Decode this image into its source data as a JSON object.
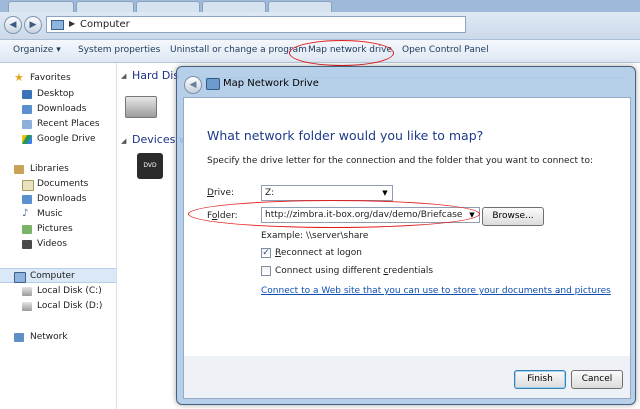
{
  "explorer": {
    "address": {
      "crumb": "Computer"
    },
    "toolbar": {
      "organize": "Organize",
      "system_properties": "System properties",
      "uninstall": "Uninstall or change a program",
      "map_network_drive": "Map network drive",
      "open_control_panel": "Open Control Panel"
    },
    "nav": {
      "favorites": "Favorites",
      "desktop": "Desktop",
      "downloads": "Downloads",
      "recent_places": "Recent Places",
      "google_drive": "Google Drive",
      "libraries": "Libraries",
      "documents": "Documents",
      "lib_downloads": "Downloads",
      "music": "Music",
      "pictures": "Pictures",
      "videos": "Videos",
      "computer": "Computer",
      "local_c": "Local Disk (C:)",
      "local_d": "Local Disk (D:)",
      "network": "Network"
    },
    "content": {
      "hard_disk_header": "Hard Dis",
      "devices_header": "Devices w",
      "dvd_label": "DVD"
    }
  },
  "dialog": {
    "title": "Map Network Drive",
    "heading": "What network folder would you like to map?",
    "instruction": "Specify the drive letter for the connection and the folder that you want to connect to:",
    "drive_label_pre": "",
    "drive_label_key": "D",
    "drive_label_post": "rive:",
    "drive_value": "Z:",
    "folder_label_pre": "F",
    "folder_label_key": "o",
    "folder_label_post": "lder:",
    "folder_value": "http://zimbra.it-box.org/dav/demo/Briefcase",
    "browse_label": "Browse...",
    "example": "Example: \\\\server\\share",
    "reconnect_pre": "",
    "reconnect_key": "R",
    "reconnect_post": "econnect at logon",
    "reconnect_checked": true,
    "credentials_pre": "Connect using different ",
    "credentials_key": "c",
    "credentials_post": "redentials",
    "credentials_checked": false,
    "web_link": "Connect to a Web site that you can use to store your documents and pictures",
    "web_link_end": ".",
    "finish_label": "Finish",
    "cancel_label": "Cancel"
  },
  "colors": {
    "annotation": "#e01b1b",
    "heading": "#1e3a8a",
    "link": "#0f4fb5"
  }
}
